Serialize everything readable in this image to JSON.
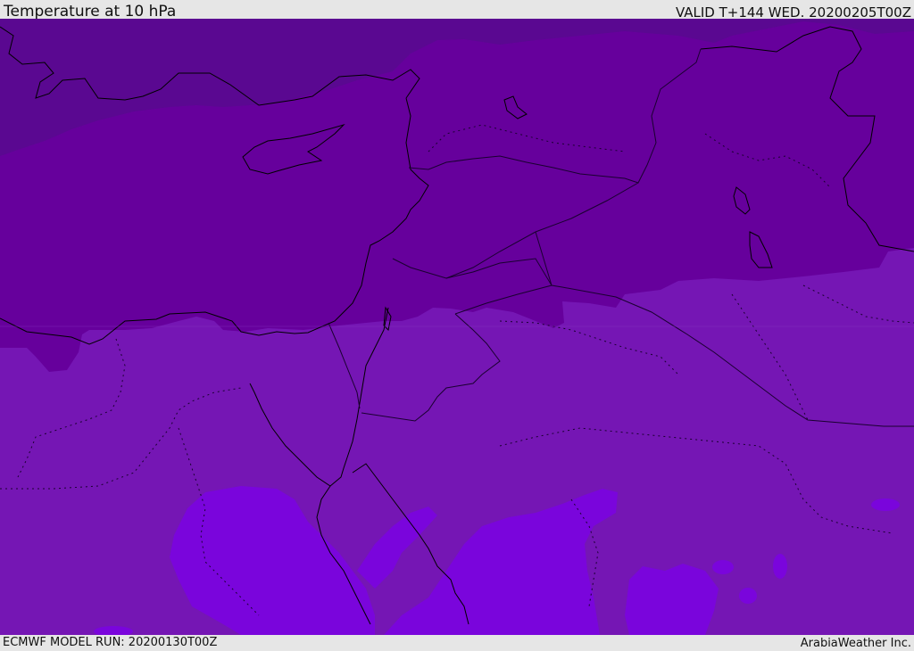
{
  "header": {
    "title": "Temperature at 10 hPa",
    "valid": "VALID T+144 WED. 20200205T00Z"
  },
  "footer": {
    "model_run": "ECMWF MODEL RUN: 20200130T00Z",
    "credit": "ArabiaWeather Inc."
  },
  "map": {
    "colors": {
      "band_coldest": "#5a0891",
      "band_cold": "#66009c",
      "band_mid": "#7516b4",
      "band_warm": "#7a05dc",
      "coastline": "#000000",
      "border": "#1a0030"
    }
  }
}
